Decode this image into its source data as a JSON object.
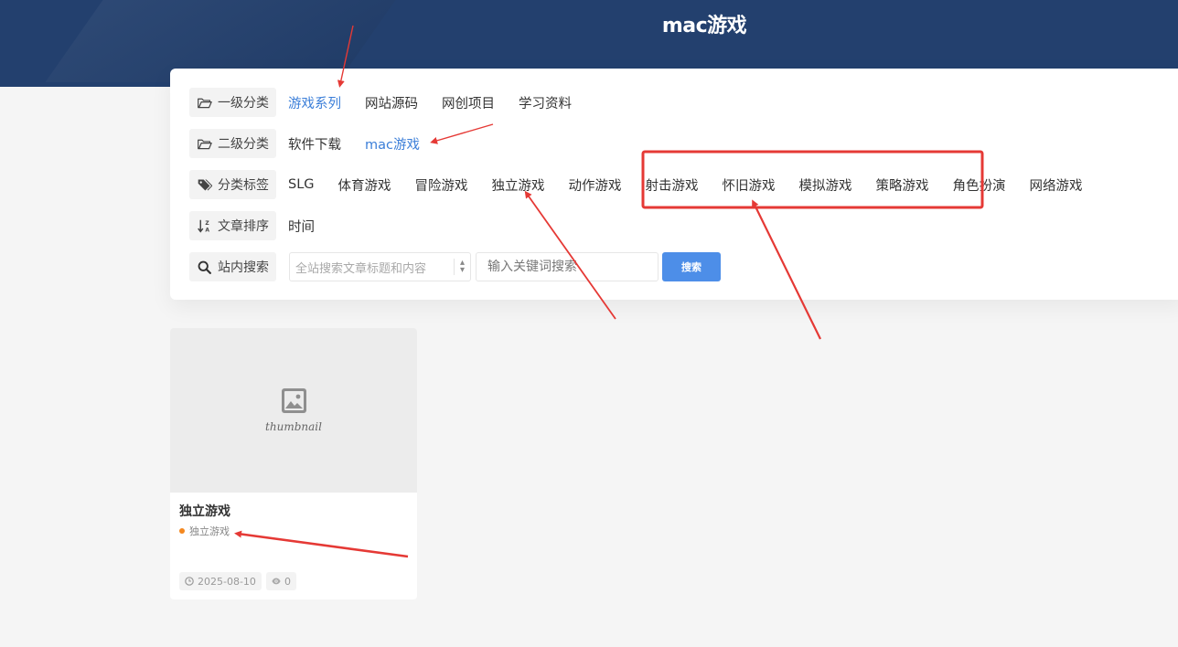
{
  "header": {
    "title": "mac游戏"
  },
  "filters": {
    "level1": {
      "label": "一级分类",
      "icon": "folder-open-icon",
      "options": [
        {
          "label": "游戏系列",
          "active": true
        },
        {
          "label": "网站源码",
          "active": false
        },
        {
          "label": "网创项目",
          "active": false
        },
        {
          "label": "学习资料",
          "active": false
        }
      ]
    },
    "level2": {
      "label": "二级分类",
      "icon": "folder-open-icon",
      "options": [
        {
          "label": "软件下载",
          "active": false
        },
        {
          "label": "mac游戏",
          "active": true
        }
      ]
    },
    "tags": {
      "label": "分类标签",
      "icon": "tags-icon",
      "options": [
        {
          "label": "SLG"
        },
        {
          "label": "体育游戏"
        },
        {
          "label": "冒险游戏"
        },
        {
          "label": "独立游戏"
        },
        {
          "label": "动作游戏"
        },
        {
          "label": "射击游戏"
        },
        {
          "label": "怀旧游戏"
        },
        {
          "label": "模拟游戏"
        },
        {
          "label": "策略游戏"
        },
        {
          "label": "角色扮演"
        },
        {
          "label": "网络游戏"
        }
      ]
    },
    "sort": {
      "label": "文章排序",
      "icon": "sort-alpha-icon",
      "options": [
        {
          "label": "时间"
        }
      ]
    },
    "search": {
      "label": "站内搜索",
      "icon": "search-icon",
      "scope_value": "全站搜索文章标题和内容",
      "input_placeholder": "输入关键词搜索",
      "button_label": "搜索"
    }
  },
  "posts": [
    {
      "thumbnail_text": "thumbnail",
      "title": "独立游戏",
      "category": "独立游戏",
      "date": "2025-08-10",
      "views": "0"
    }
  ],
  "colors": {
    "header_bg": "#23406e",
    "accent": "#3b7ed8",
    "button": "#4d8ee8",
    "annotation": "#e53935",
    "category_dot": "#f4881f"
  }
}
